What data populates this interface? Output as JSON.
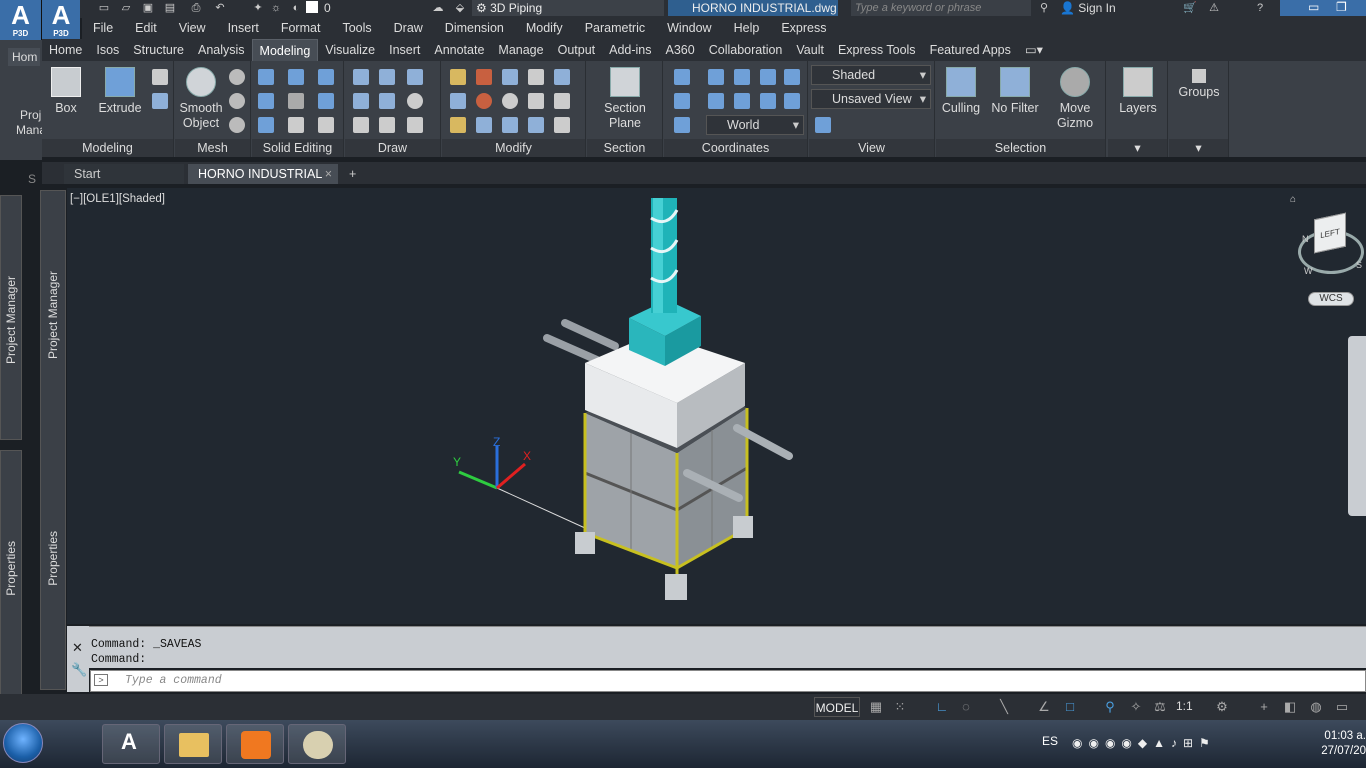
{
  "app": {
    "product_short": "P3D",
    "workspace": "3D Piping",
    "file_title": "HORNO INDUSTRIAL.dwg",
    "search_placeholder": "Type a keyword or phrase",
    "sign_in": "Sign In",
    "layer_value": "0"
  },
  "menu": [
    "File",
    "Edit",
    "View",
    "Insert",
    "Format",
    "Tools",
    "Draw",
    "Dimension",
    "Modify",
    "Parametric",
    "Window",
    "Help",
    "Express"
  ],
  "ribbon_tabs": [
    "Home",
    "Isos",
    "Structure",
    "Analysis",
    "Modeling",
    "Visualize",
    "Insert",
    "Annotate",
    "Manage",
    "Output",
    "Add-ins",
    "A360",
    "Collaboration",
    "Vault",
    "Express Tools",
    "Featured Apps"
  ],
  "active_tab": "Modeling",
  "left_home": {
    "label": "Hom",
    "proj": "Proj",
    "mana": "Mana"
  },
  "ribbon": {
    "modeling": {
      "box": "Box",
      "extrude": "Extrude",
      "footer": "Modeling"
    },
    "mesh": {
      "smooth": "Smooth",
      "object": "Object",
      "footer": "Mesh"
    },
    "solid_editing": {
      "footer": "Solid Editing"
    },
    "draw": {
      "footer": "Draw"
    },
    "modify": {
      "footer": "Modify"
    },
    "section": {
      "plane1": "Section",
      "plane2": "Plane",
      "footer": "Section"
    },
    "coordinates": {
      "world": "World",
      "footer": "Coordinates"
    },
    "view": {
      "visual_style": "Shaded",
      "named_view": "Unsaved View",
      "footer": "View"
    },
    "selection": {
      "culling": "Culling",
      "nofilter": "No Filter",
      "move": "Move",
      "gizmo": "Gizmo",
      "footer": "Selection"
    },
    "layers": {
      "label": "Layers"
    },
    "groups": {
      "label": "Groups"
    }
  },
  "doc_tabs": {
    "start": "Start",
    "active": "HORNO INDUSTRIAL",
    "close": "×",
    "add": "+"
  },
  "side_panels": {
    "project_manager": "Project Manager",
    "properties": "Properties",
    "short": "S"
  },
  "viewport": {
    "label": "[−][OLE1][Shaded]"
  },
  "viewcube": {
    "face": "LEFT",
    "wcs": "WCS",
    "north": "N",
    "south": "S",
    "west": "W"
  },
  "command": {
    "history": [
      "Command:  _SAVEAS",
      "Command:"
    ],
    "placeholder": "Type a command"
  },
  "status": {
    "model": "MODEL",
    "scale": "1:1"
  },
  "taskbar": {
    "lang": "ES",
    "time": "01:03 a.",
    "date": "27/07/20"
  },
  "colors": {
    "accent": "#3a6ea8",
    "ribbon_bg": "#3b4047",
    "viewport_bg": "#212830",
    "chimney": "#1fb3b8"
  }
}
